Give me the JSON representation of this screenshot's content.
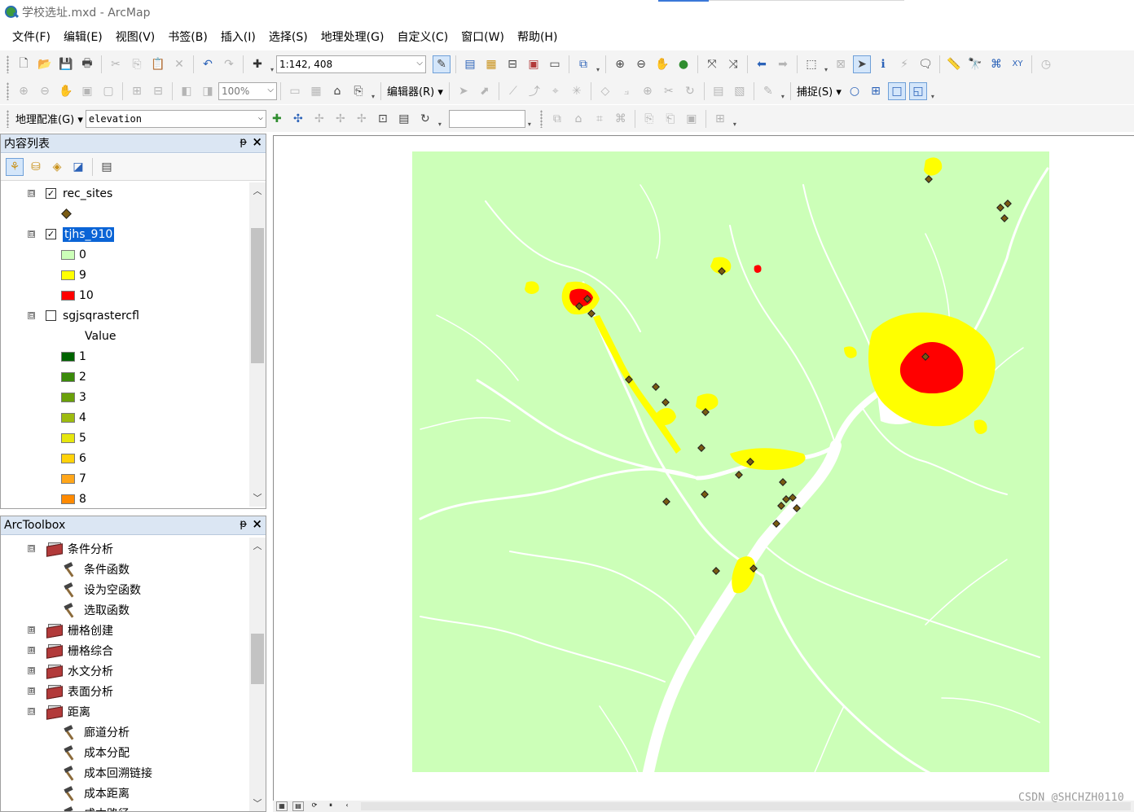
{
  "window": {
    "title": "学校选址.mxd - ArcMap"
  },
  "menu": [
    "文件(F)",
    "编辑(E)",
    "视图(V)",
    "书签(B)",
    "插入(I)",
    "选择(S)",
    "地理处理(G)",
    "自定义(C)",
    "窗口(W)",
    "帮助(H)"
  ],
  "toolbar": {
    "scale_value": "1:142, 408",
    "zoom_percent": "100%",
    "editor_label": "编辑器(R)",
    "snapping_label": "捕捉(S)",
    "georef_label": "地理配准(G)",
    "georef_layer": "elevation",
    "georef_input": ""
  },
  "toc": {
    "title": "内容列表",
    "pin": "ᵽ",
    "close": "×",
    "layers": [
      {
        "name": "rec_sites",
        "checked": true,
        "expanded": true,
        "expander": "⊟",
        "check_mark": "✓"
      },
      {
        "name": "tjhs_910",
        "checked": true,
        "expanded": true,
        "selected": true,
        "expander": "⊟",
        "check_mark": "✓",
        "classes": [
          {
            "label": "0",
            "color": "#ccffb8"
          },
          {
            "label": "9",
            "color": "#ffff00"
          },
          {
            "label": "10",
            "color": "#ff0000"
          }
        ]
      },
      {
        "name": "sgjsqrastercfl",
        "checked": false,
        "expanded": true,
        "expander": "⊟",
        "check_mark": "",
        "field_label": "Value",
        "classes": [
          {
            "label": "1",
            "color": "#006400"
          },
          {
            "label": "2",
            "color": "#3a8a0a"
          },
          {
            "label": "3",
            "color": "#6aa00a"
          },
          {
            "label": "4",
            "color": "#9dbb0f"
          },
          {
            "label": "5",
            "color": "#e6e60e"
          },
          {
            "label": "6",
            "color": "#ffd20a"
          },
          {
            "label": "7",
            "color": "#ffa61a"
          },
          {
            "label": "8",
            "color": "#ff8a00"
          }
        ]
      }
    ]
  },
  "toolbox": {
    "title": "ArcToolbox",
    "pin": "ᵽ",
    "close": "×",
    "items": [
      {
        "label": "条件分析",
        "type": "toolset",
        "expander": "⊟",
        "level": 0
      },
      {
        "label": "条件函数",
        "type": "tool",
        "level": 1
      },
      {
        "label": "设为空函数",
        "type": "tool",
        "level": 1
      },
      {
        "label": "选取函数",
        "type": "tool",
        "level": 1
      },
      {
        "label": "栅格创建",
        "type": "toolset",
        "expander": "⊞",
        "level": 0
      },
      {
        "label": "栅格综合",
        "type": "toolset",
        "expander": "⊞",
        "level": 0
      },
      {
        "label": "水文分析",
        "type": "toolset",
        "expander": "⊞",
        "level": 0
      },
      {
        "label": "表面分析",
        "type": "toolset",
        "expander": "⊞",
        "level": 0
      },
      {
        "label": "距离",
        "type": "toolset",
        "expander": "⊟",
        "level": 0
      },
      {
        "label": "廊道分析",
        "type": "tool",
        "level": 1
      },
      {
        "label": "成本分配",
        "type": "tool",
        "level": 1
      },
      {
        "label": "成本回溯链接",
        "type": "tool",
        "level": 1
      },
      {
        "label": "成本距离",
        "type": "tool",
        "level": 1
      },
      {
        "label": "成本路径",
        "type": "tool",
        "level": 1
      }
    ]
  },
  "map": {
    "background": "#ccffb8",
    "suitable_color": "#ffff00",
    "most_suitable_color": "#ff0000",
    "site_color": "#7a5b12"
  },
  "watermark": "CSDN @SHCHZH0110",
  "colors": {
    "panel_header": "#dbe6f3",
    "selection": "#0a64d6"
  }
}
